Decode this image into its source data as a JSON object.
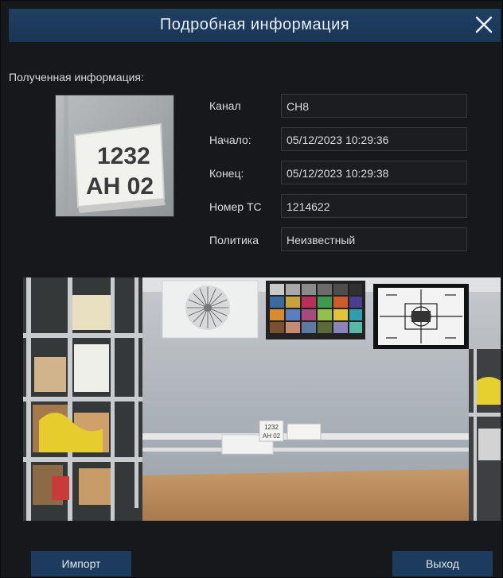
{
  "dialog": {
    "title": "Подробная информация",
    "close_icon": "close-icon"
  },
  "info": {
    "section_label": "Полученная информация:",
    "plate_text_line1": "1232",
    "plate_text_line2": "AH 02",
    "fields": [
      {
        "label": "Канал",
        "value": "CH8"
      },
      {
        "label": "Начало:",
        "value": "05/12/2023 10:29:36"
      },
      {
        "label": "Конец:",
        "value": "05/12/2023 10:29:38"
      },
      {
        "label": "Номер ТС",
        "value": "1214622"
      },
      {
        "label": "Политика",
        "value": "Неизвестный"
      }
    ]
  },
  "scene": {
    "plate_line1": "1232",
    "plate_line2": "AH 02"
  },
  "buttons": {
    "import_label": "Импорт",
    "exit_label": "Выход"
  },
  "colors": {
    "titlebar": "#1f3f63",
    "background": "#17181b",
    "button": "#1d3b5c"
  }
}
